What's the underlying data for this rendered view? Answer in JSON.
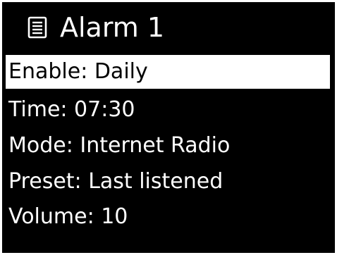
{
  "header": {
    "icon": "list-document-icon",
    "title": "Alarm 1"
  },
  "menu": {
    "selected_index": 0,
    "items": [
      {
        "label": "Enable: Daily"
      },
      {
        "label": "Time: 07:30"
      },
      {
        "label": "Mode: Internet Radio"
      },
      {
        "label": "Preset: Last listened"
      },
      {
        "label": "Volume: 10"
      }
    ]
  },
  "colors": {
    "background": "#000000",
    "text": "#ffffff",
    "highlight_background": "#ffffff",
    "highlight_text": "#000000"
  }
}
